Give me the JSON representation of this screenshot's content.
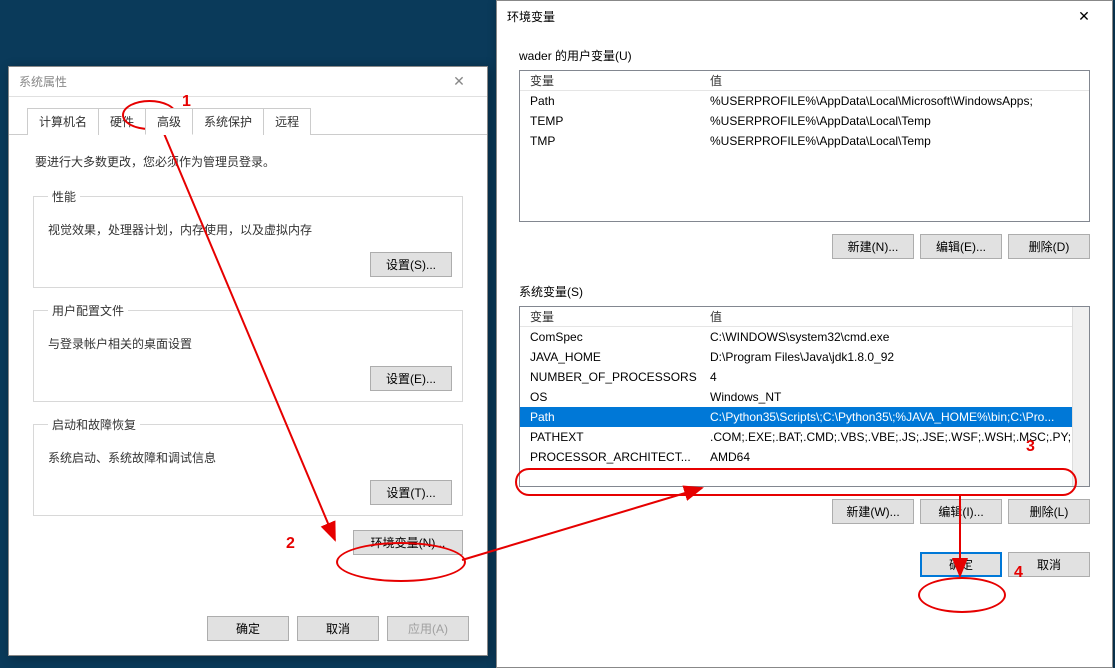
{
  "sysprop": {
    "title": "系统属性",
    "tabs": [
      "计算机名",
      "硬件",
      "高级",
      "系统保护",
      "远程"
    ],
    "intro": "要进行大多数更改，您必须作为管理员登录。",
    "perf": {
      "legend": "性能",
      "desc": "视觉效果，处理器计划，内存使用，以及虚拟内存",
      "btn": "设置(S)..."
    },
    "profile": {
      "legend": "用户配置文件",
      "desc": "与登录帐户相关的桌面设置",
      "btn": "设置(E)..."
    },
    "startup": {
      "legend": "启动和故障恢复",
      "desc": "系统启动、系统故障和调试信息",
      "btn": "设置(T)..."
    },
    "envbtn": "环境变量(N)...",
    "ok": "确定",
    "cancel": "取消",
    "apply": "应用(A)"
  },
  "env": {
    "title": "环境变量",
    "user_label": "wader 的用户变量(U)",
    "col_var": "变量",
    "col_val": "值",
    "user_rows": [
      {
        "var": "Path",
        "val": "%USERPROFILE%\\AppData\\Local\\Microsoft\\WindowsApps;"
      },
      {
        "var": "TEMP",
        "val": "%USERPROFILE%\\AppData\\Local\\Temp"
      },
      {
        "var": "TMP",
        "val": "%USERPROFILE%\\AppData\\Local\\Temp"
      }
    ],
    "user_new": "新建(N)...",
    "user_edit": "编辑(E)...",
    "user_del": "删除(D)",
    "sys_label": "系统变量(S)",
    "sys_rows": [
      {
        "var": "ComSpec",
        "val": "C:\\WINDOWS\\system32\\cmd.exe"
      },
      {
        "var": "JAVA_HOME",
        "val": "D:\\Program Files\\Java\\jdk1.8.0_92"
      },
      {
        "var": "NUMBER_OF_PROCESSORS",
        "val": "4"
      },
      {
        "var": "OS",
        "val": "Windows_NT"
      },
      {
        "var": "Path",
        "val": "C:\\Python35\\Scripts\\;C:\\Python35\\;%JAVA_HOME%\\bin;C:\\Pro..."
      },
      {
        "var": "PATHEXT",
        "val": ".COM;.EXE;.BAT;.CMD;.VBS;.VBE;.JS;.JSE;.WSF;.WSH;.MSC;.PY;.P..."
      },
      {
        "var": "PROCESSOR_ARCHITECT...",
        "val": "AMD64"
      }
    ],
    "sys_new": "新建(W)...",
    "sys_edit": "编辑(I)...",
    "sys_del": "删除(L)",
    "ok": "确定",
    "cancel": "取消"
  },
  "anno": {
    "n1": "1",
    "n2": "2",
    "n3": "3",
    "n4": "4"
  }
}
